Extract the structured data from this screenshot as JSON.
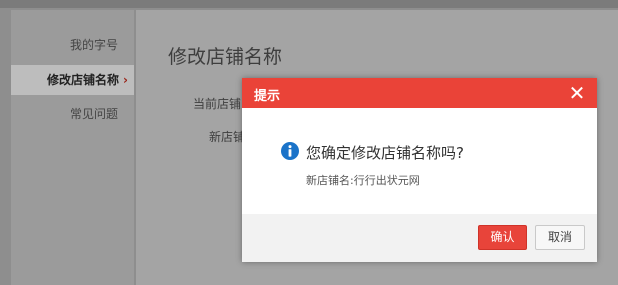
{
  "sidebar": {
    "items": [
      {
        "label": "我的字号"
      },
      {
        "label": "修改店铺名称",
        "chevron": "›"
      },
      {
        "label": "常见问题"
      }
    ]
  },
  "main": {
    "title": "修改店铺名称",
    "current_name_label": "当前店铺",
    "new_name_label": "新店铺"
  },
  "dialog": {
    "title": "提示",
    "close_glyph": "✕",
    "icon": "info-icon",
    "question": "您确定修改店铺名称吗?",
    "detail": "新店铺名:行行出状元网",
    "confirm_label": "确认",
    "cancel_label": "取消"
  },
  "colors": {
    "accent": "#ea4338",
    "info_blue": "#1a73c9"
  }
}
